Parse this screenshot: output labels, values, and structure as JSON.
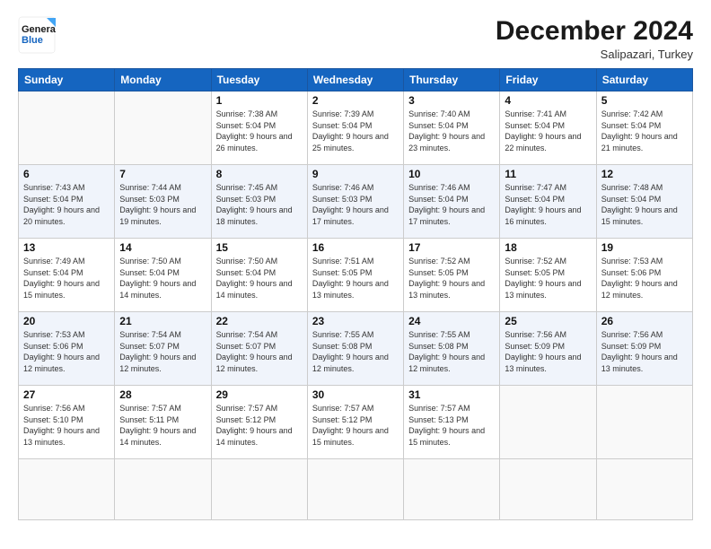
{
  "logo": {
    "line1": "General",
    "line2": "Blue"
  },
  "title": "December 2024",
  "subtitle": "Salipazari, Turkey",
  "weekdays": [
    "Sunday",
    "Monday",
    "Tuesday",
    "Wednesday",
    "Thursday",
    "Friday",
    "Saturday"
  ],
  "days": [
    null,
    null,
    {
      "num": "1",
      "sunrise": "7:38 AM",
      "sunset": "5:04 PM",
      "daylight": "9 hours and 26 minutes."
    },
    {
      "num": "2",
      "sunrise": "7:39 AM",
      "sunset": "5:04 PM",
      "daylight": "9 hours and 25 minutes."
    },
    {
      "num": "3",
      "sunrise": "7:40 AM",
      "sunset": "5:04 PM",
      "daylight": "9 hours and 23 minutes."
    },
    {
      "num": "4",
      "sunrise": "7:41 AM",
      "sunset": "5:04 PM",
      "daylight": "9 hours and 22 minutes."
    },
    {
      "num": "5",
      "sunrise": "7:42 AM",
      "sunset": "5:04 PM",
      "daylight": "9 hours and 21 minutes."
    },
    {
      "num": "6",
      "sunrise": "7:43 AM",
      "sunset": "5:04 PM",
      "daylight": "9 hours and 20 minutes."
    },
    {
      "num": "7",
      "sunrise": "7:44 AM",
      "sunset": "5:03 PM",
      "daylight": "9 hours and 19 minutes."
    },
    {
      "num": "8",
      "sunrise": "7:45 AM",
      "sunset": "5:03 PM",
      "daylight": "9 hours and 18 minutes."
    },
    {
      "num": "9",
      "sunrise": "7:46 AM",
      "sunset": "5:03 PM",
      "daylight": "9 hours and 17 minutes."
    },
    {
      "num": "10",
      "sunrise": "7:46 AM",
      "sunset": "5:04 PM",
      "daylight": "9 hours and 17 minutes."
    },
    {
      "num": "11",
      "sunrise": "7:47 AM",
      "sunset": "5:04 PM",
      "daylight": "9 hours and 16 minutes."
    },
    {
      "num": "12",
      "sunrise": "7:48 AM",
      "sunset": "5:04 PM",
      "daylight": "9 hours and 15 minutes."
    },
    {
      "num": "13",
      "sunrise": "7:49 AM",
      "sunset": "5:04 PM",
      "daylight": "9 hours and 15 minutes."
    },
    {
      "num": "14",
      "sunrise": "7:50 AM",
      "sunset": "5:04 PM",
      "daylight": "9 hours and 14 minutes."
    },
    {
      "num": "15",
      "sunrise": "7:50 AM",
      "sunset": "5:04 PM",
      "daylight": "9 hours and 14 minutes."
    },
    {
      "num": "16",
      "sunrise": "7:51 AM",
      "sunset": "5:05 PM",
      "daylight": "9 hours and 13 minutes."
    },
    {
      "num": "17",
      "sunrise": "7:52 AM",
      "sunset": "5:05 PM",
      "daylight": "9 hours and 13 minutes."
    },
    {
      "num": "18",
      "sunrise": "7:52 AM",
      "sunset": "5:05 PM",
      "daylight": "9 hours and 13 minutes."
    },
    {
      "num": "19",
      "sunrise": "7:53 AM",
      "sunset": "5:06 PM",
      "daylight": "9 hours and 12 minutes."
    },
    {
      "num": "20",
      "sunrise": "7:53 AM",
      "sunset": "5:06 PM",
      "daylight": "9 hours and 12 minutes."
    },
    {
      "num": "21",
      "sunrise": "7:54 AM",
      "sunset": "5:07 PM",
      "daylight": "9 hours and 12 minutes."
    },
    {
      "num": "22",
      "sunrise": "7:54 AM",
      "sunset": "5:07 PM",
      "daylight": "9 hours and 12 minutes."
    },
    {
      "num": "23",
      "sunrise": "7:55 AM",
      "sunset": "5:08 PM",
      "daylight": "9 hours and 12 minutes."
    },
    {
      "num": "24",
      "sunrise": "7:55 AM",
      "sunset": "5:08 PM",
      "daylight": "9 hours and 12 minutes."
    },
    {
      "num": "25",
      "sunrise": "7:56 AM",
      "sunset": "5:09 PM",
      "daylight": "9 hours and 13 minutes."
    },
    {
      "num": "26",
      "sunrise": "7:56 AM",
      "sunset": "5:09 PM",
      "daylight": "9 hours and 13 minutes."
    },
    {
      "num": "27",
      "sunrise": "7:56 AM",
      "sunset": "5:10 PM",
      "daylight": "9 hours and 13 minutes."
    },
    {
      "num": "28",
      "sunrise": "7:57 AM",
      "sunset": "5:11 PM",
      "daylight": "9 hours and 14 minutes."
    },
    {
      "num": "29",
      "sunrise": "7:57 AM",
      "sunset": "5:12 PM",
      "daylight": "9 hours and 14 minutes."
    },
    {
      "num": "30",
      "sunrise": "7:57 AM",
      "sunset": "5:12 PM",
      "daylight": "9 hours and 15 minutes."
    },
    {
      "num": "31",
      "sunrise": "7:57 AM",
      "sunset": "5:13 PM",
      "daylight": "9 hours and 15 minutes."
    },
    null,
    null,
    null,
    null
  ]
}
